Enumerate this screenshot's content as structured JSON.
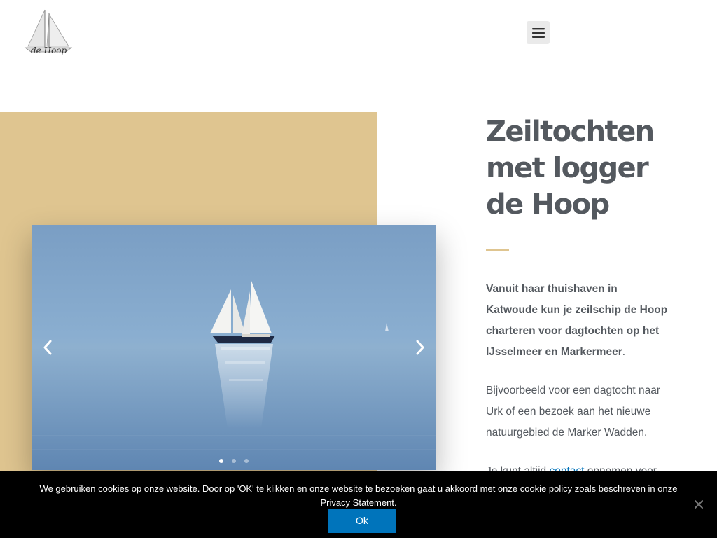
{
  "header": {
    "logo_text": "de Hoop",
    "menu_icon": "hamburger-menu-icon"
  },
  "hero": {
    "title_lines": [
      "Zeiltochten",
      "met logger",
      "de Hoop"
    ],
    "intro_bold": "Vanuit haar thuishaven in Katwoude kun je zeilschip de Hoop charteren voor dagtochten op het IJsselmeer en Markermeer",
    "intro_end": ".",
    "paragraph_2": "Bijvoorbeeld voor een dagtocht naar Urk of een bezoek aan het nieuwe natuurgebied de Marker Wadden.",
    "paragraph_3_before": "Je kunt altijd ",
    "paragraph_3_link": "contact",
    "paragraph_3_after": " opnemen voor"
  },
  "slider": {
    "prev_icon": "chevron-left-icon",
    "next_icon": "chevron-right-icon",
    "slide_count": 3,
    "active_slide": 1
  },
  "cookie_notice": {
    "text_line_1": "We gebruiken cookies op onze website. Door op 'OK' te klikken en onze website te bezoeken gaat u akkoord met onze cookie policy zoals beschreven in onze",
    "link_text": "Privacy Statement",
    "text_end": ".",
    "ok_label": "Ok",
    "close_icon": "close-icon"
  },
  "colors": {
    "accent_tan": "#dfc590",
    "heading": "#54595f",
    "link": "#0072b9",
    "button": "#0074bb"
  }
}
